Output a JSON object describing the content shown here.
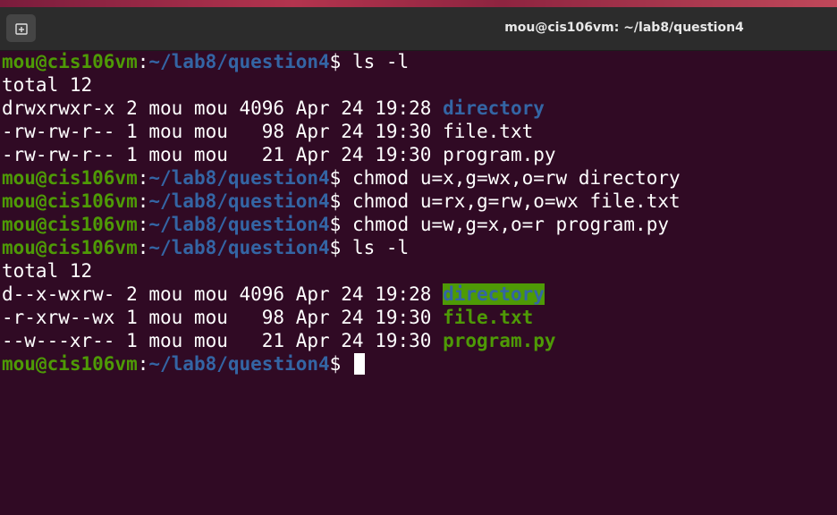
{
  "window": {
    "title": "mou@cis106vm: ~/lab8/question4",
    "new_tab_icon": "plus-tab-icon"
  },
  "colors": {
    "background": "#300a24",
    "prompt_user": "#4e9a06",
    "prompt_path": "#3465a4",
    "directory": "#3465a4",
    "executable": "#4e9a06",
    "text": "#ffffff"
  },
  "prompt": {
    "user": "mou@cis106vm",
    "colon": ":",
    "path": "~/lab8/question4",
    "dollar": "$ "
  },
  "lines": [
    {
      "type": "prompt",
      "command": "ls -l"
    },
    {
      "type": "text",
      "text": "total 12"
    },
    {
      "type": "entry",
      "meta": "drwxrwxr-x 2 mou mou 4096 Apr 24 19:28 ",
      "name": "directory",
      "style": "d"
    },
    {
      "type": "entry",
      "meta": "-rw-rw-r-- 1 mou mou   98 Apr 24 19:30 ",
      "name": "file.txt",
      "style": "plain"
    },
    {
      "type": "entry",
      "meta": "-rw-rw-r-- 1 mou mou   21 Apr 24 19:30 ",
      "name": "program.py",
      "style": "plain"
    },
    {
      "type": "prompt",
      "command": "chmod u=x,g=wx,o=rw directory"
    },
    {
      "type": "prompt",
      "command": "chmod u=rx,g=rw,o=wx file.txt"
    },
    {
      "type": "prompt",
      "command": "chmod u=w,g=x,o=r program.py"
    },
    {
      "type": "prompt",
      "command": "ls -l"
    },
    {
      "type": "text",
      "text": "total 12"
    },
    {
      "type": "entry",
      "meta": "d--x-wxrw- 2 mou mou 4096 Apr 24 19:28 ",
      "name": "directory",
      "style": "dhl"
    },
    {
      "type": "entry",
      "meta": "-r-xrw--wx 1 mou mou   98 Apr 24 19:30 ",
      "name": "file.txt",
      "style": "g"
    },
    {
      "type": "entry",
      "meta": "--w---xr-- 1 mou mou   21 Apr 24 19:30 ",
      "name": "program.py",
      "style": "g"
    },
    {
      "type": "prompt",
      "command": "",
      "cursor": true
    }
  ]
}
